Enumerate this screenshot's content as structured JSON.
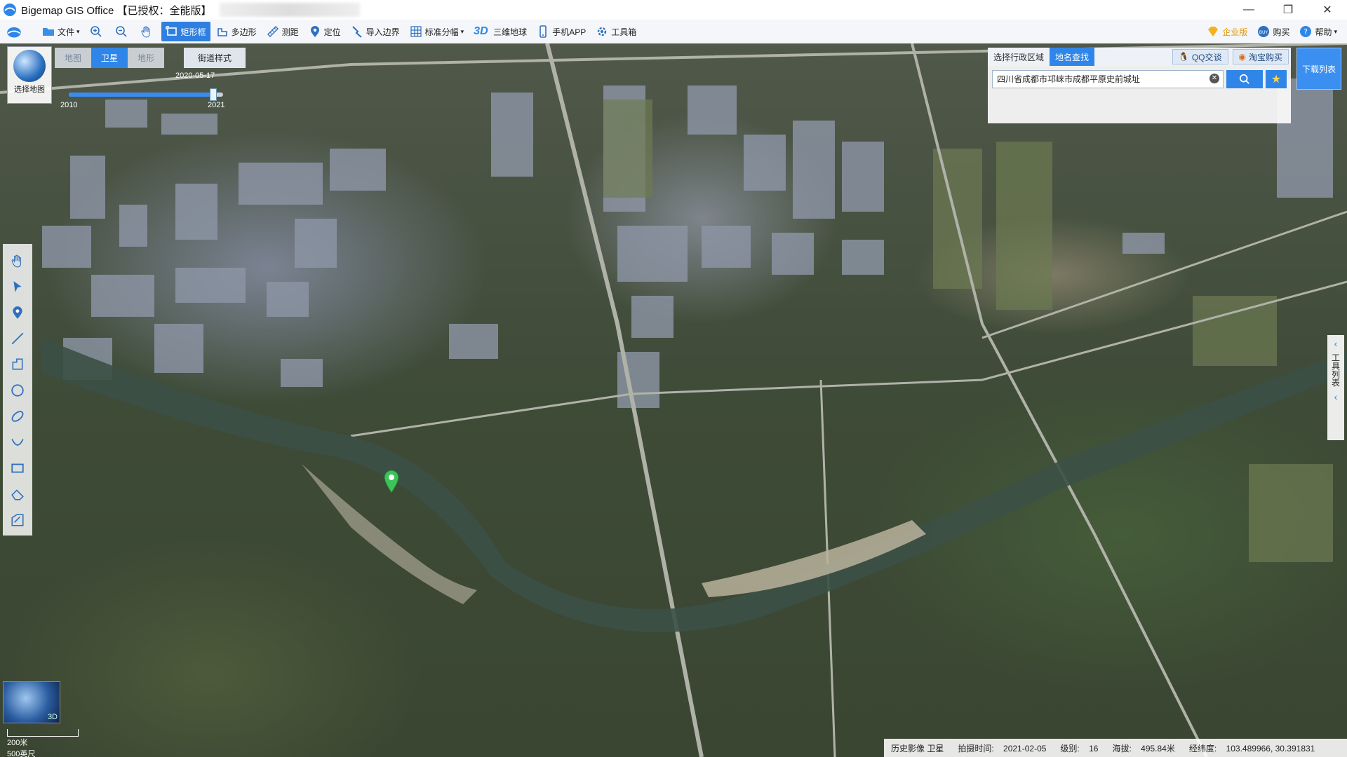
{
  "window": {
    "title": "Bigemap GIS Office 【已授权：全能版】",
    "controls": [
      "—",
      "❐",
      "✕"
    ]
  },
  "toolbar": {
    "items": [
      {
        "label": "文件",
        "caret": true,
        "icon": "folder-icon"
      },
      {
        "label": "",
        "icon": "zoom-in-icon"
      },
      {
        "label": "",
        "icon": "zoom-out-icon"
      },
      {
        "label": "",
        "icon": "hand-pan-icon"
      },
      {
        "label": "矩形框",
        "icon": "rect-select-icon",
        "active": true
      },
      {
        "label": "多边形",
        "icon": "polygon-icon"
      },
      {
        "label": "测距",
        "icon": "ruler-icon"
      },
      {
        "label": "定位",
        "icon": "location-pin-icon"
      },
      {
        "label": "导入边界",
        "icon": "import-boundary-icon"
      },
      {
        "label": "标准分幅",
        "caret": true,
        "icon": "grid-icon"
      },
      {
        "label": "三维地球",
        "icon": "3d-globe-icon"
      },
      {
        "label": "手机APP",
        "icon": "mobile-icon"
      },
      {
        "label": "工具箱",
        "icon": "gear-icon"
      }
    ],
    "right": [
      {
        "label": "企业版",
        "icon": "diamond-icon"
      },
      {
        "label": "购买",
        "icon": "buy-icon"
      },
      {
        "label": "帮助",
        "caret": true,
        "icon": "help-icon"
      }
    ]
  },
  "map": {
    "select_map_label": "选择地图",
    "types": [
      {
        "label": "地图",
        "selected": false
      },
      {
        "label": "卫星",
        "selected": true
      },
      {
        "label": "地形",
        "selected": false
      }
    ],
    "street_style": "街道样式",
    "timeline": {
      "current_date": "2020-05-17",
      "start_year": "2010",
      "end_year": "2021",
      "progress": 0.93
    },
    "minimap_label": "3D",
    "scale": {
      "metric": "200米",
      "imperial": "500英尺"
    }
  },
  "search": {
    "tabs": [
      {
        "label": "选择行政区域",
        "selected": false
      },
      {
        "label": "地名查找",
        "selected": true
      }
    ],
    "qq_button": "QQ交谈",
    "taobao_button": "淘宝购买",
    "value": "四川省成都市邛崃市成都平原史前城址"
  },
  "download_list": "下载列表",
  "right_panel": "工具列表",
  "status": {
    "source": "历史影像 卫星",
    "capture_label": "拍摄时间:",
    "capture_time": "2021-02-05",
    "level_label": "级别:",
    "level": "16",
    "altitude_label": "海拔:",
    "altitude": "495.84米",
    "coord_label": "经纬度:",
    "coords": "103.489966, 30.391831"
  },
  "colors": {
    "accent": "#2f86e8",
    "toolbar_bg": "#f4f6f9",
    "marker": "#3cc35a"
  }
}
